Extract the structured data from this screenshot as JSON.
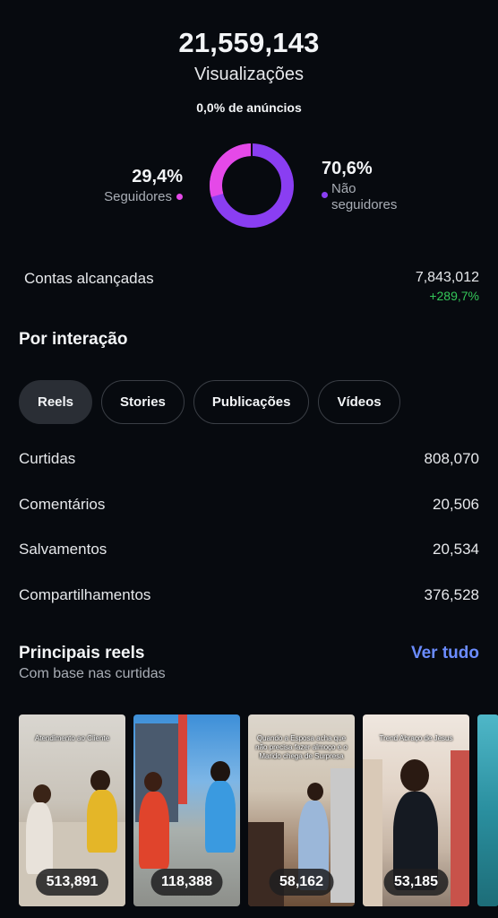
{
  "summary": {
    "views_count": "21,559,143",
    "views_label": "Visualizações",
    "ads_label": "0,0% de anúncios"
  },
  "audience_split": {
    "followers": {
      "percent": "29,4%",
      "label": "Seguidores",
      "value": 29.4,
      "color": "#e549e8"
    },
    "non_followers": {
      "percent": "70,6%",
      "label": "Não seguidores",
      "value": 70.6,
      "color": "#8a3ef2"
    }
  },
  "reach": {
    "label": "Contas alcançadas",
    "value": "7,843,012",
    "change": "+289,7%"
  },
  "interaction": {
    "title": "Por interação",
    "tabs": [
      {
        "label": "Reels",
        "active": true
      },
      {
        "label": "Stories",
        "active": false
      },
      {
        "label": "Publicações",
        "active": false
      },
      {
        "label": "Vídeos",
        "active": false
      }
    ],
    "metrics": [
      {
        "label": "Curtidas",
        "value": "808,070"
      },
      {
        "label": "Comentários",
        "value": "20,506"
      },
      {
        "label": "Salvamentos",
        "value": "20,534"
      },
      {
        "label": "Compartilhamentos",
        "value": "376,528"
      }
    ]
  },
  "top_reels": {
    "title": "Principais reels",
    "subtitle": "Com base nas curtidas",
    "see_all_label": "Ver tudo",
    "items": [
      {
        "caption": "Atendimento ao Cliente",
        "count": "513,891"
      },
      {
        "caption": "",
        "count": "118,388"
      },
      {
        "caption": "Quando a Esposa acha que não precisa fazer almoço e o Marido chega de Surpresa",
        "count": "58,162"
      },
      {
        "caption": "Trend Abraço de Jesus",
        "count": "53,185"
      }
    ]
  }
}
